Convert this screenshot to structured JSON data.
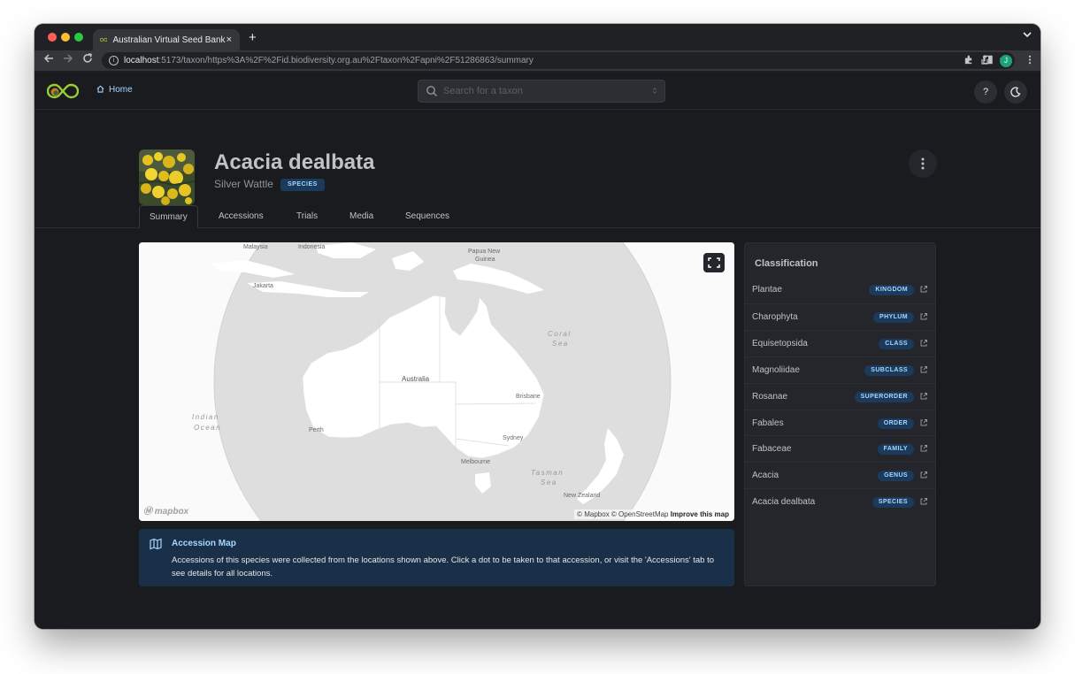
{
  "browser": {
    "tab_title": "Australian Virtual Seed Bank",
    "tab_close": "×",
    "new_tab": "+",
    "url_host": "localhost",
    "url_path": ":5173/taxon/https%3A%2F%2Fid.biodiversity.org.au%2Ftaxon%2Fapni%2F51286863/summary",
    "profile_initial": "J"
  },
  "header": {
    "home_label": "Home",
    "search_placeholder": "Search for a taxon",
    "help_label": "?"
  },
  "taxon": {
    "name": "Acacia dealbata",
    "common_name": "Silver Wattle",
    "rank": "SPECIES"
  },
  "tabs": [
    "Summary",
    "Accessions",
    "Trials",
    "Media",
    "Sequences"
  ],
  "map": {
    "labels": {
      "malaysia": "Malaysia",
      "indonesia": "Indonesia",
      "papua": "Papua New",
      "guinea": "Guinea",
      "jakarta": "Jakarta",
      "coral_sea_1": "Coral",
      "coral_sea_2": "Sea",
      "australia": "Australia",
      "brisbane": "Brisbane",
      "indian_1": "Indian",
      "indian_2": "Ocean",
      "perth": "Perth",
      "sydney": "Sydney",
      "melbourne": "Melbourne",
      "tasman_1": "Tasman",
      "tasman_2": "Sea",
      "new_zealand": "New Zealand"
    },
    "logo_text": "mapbox",
    "attribution": "© Mapbox © OpenStreetMap",
    "improve": "Improve this map"
  },
  "alert": {
    "title": "Accession Map",
    "body": "Accessions of this species were collected from the locations shown above. Click a dot to be taken to that accession, or visit the 'Accessions' tab to see details for all locations."
  },
  "classification": {
    "title": "Classification",
    "rows": [
      {
        "name": "Plantae",
        "rank": "KINGDOM"
      },
      {
        "name": "Charophyta",
        "rank": "PHYLUM"
      },
      {
        "name": "Equisetopsida",
        "rank": "CLASS"
      },
      {
        "name": "Magnoliidae",
        "rank": "SUBCLASS"
      },
      {
        "name": "Rosanae",
        "rank": "SUPERORDER"
      },
      {
        "name": "Fabales",
        "rank": "ORDER"
      },
      {
        "name": "Fabaceae",
        "rank": "FAMILY"
      },
      {
        "name": "Acacia",
        "rank": "GENUS"
      },
      {
        "name": "Acacia dealbata",
        "rank": "SPECIES"
      }
    ]
  },
  "colors": {
    "accent": "#a5d8ff",
    "badge_bg": "#1c3a5b",
    "app_bg": "#1a1b1e",
    "card_bg": "#25262b"
  }
}
